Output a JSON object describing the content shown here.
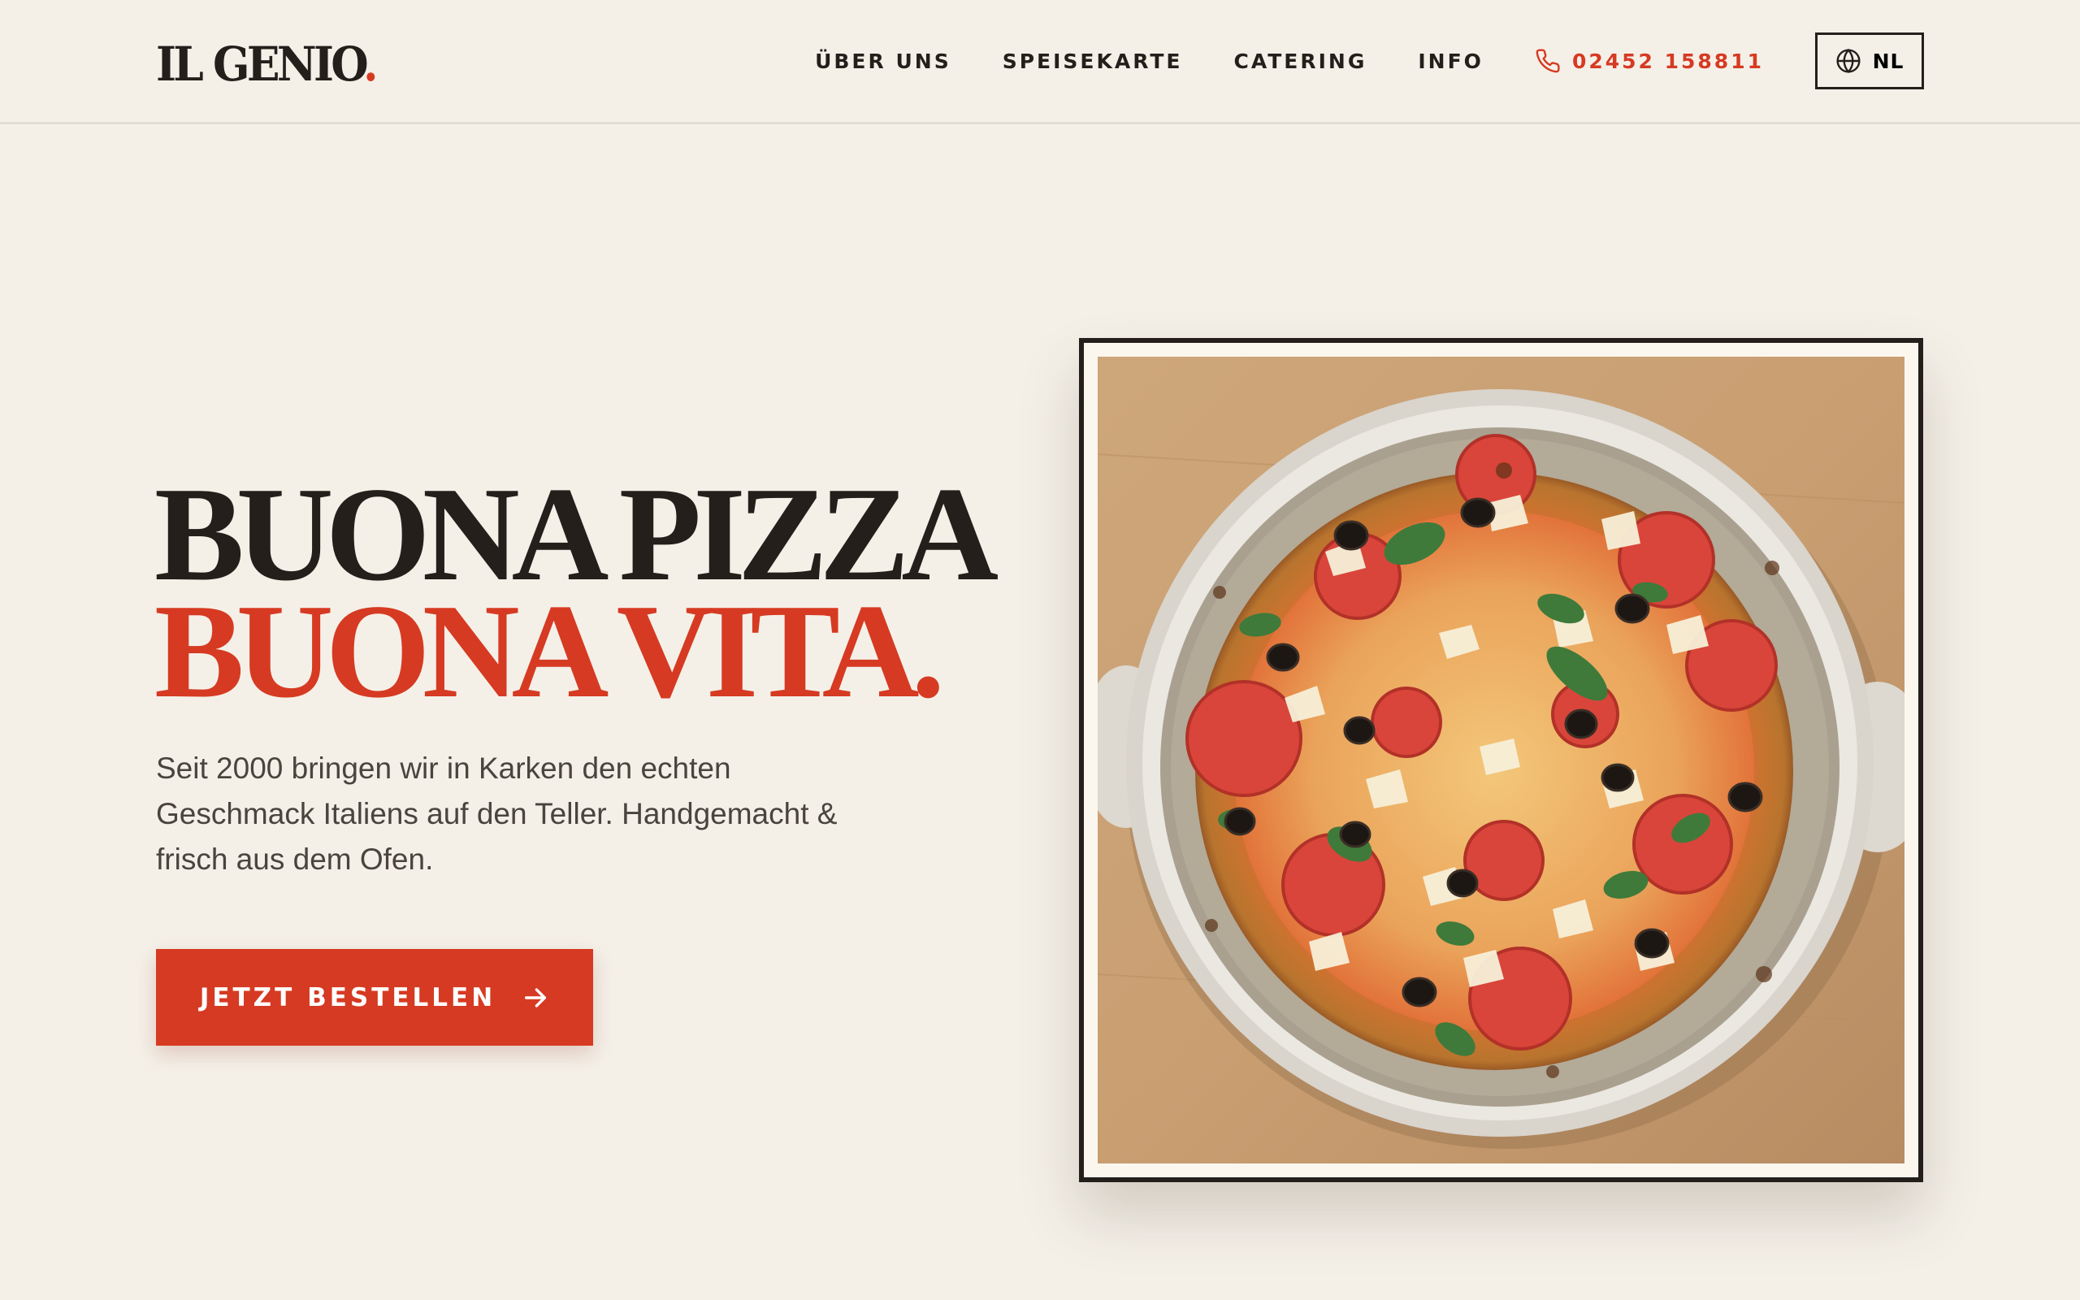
{
  "brand": {
    "logo_text": "IL GENIO",
    "logo_dot": ".",
    "accent_color": "#d63a22",
    "dark_color": "#241f1b",
    "background_color": "#f4f0e8"
  },
  "nav": {
    "items": [
      {
        "label": "ÜBER UNS"
      },
      {
        "label": "SPEISEKARTE"
      },
      {
        "label": "CATERING"
      },
      {
        "label": "INFO"
      }
    ],
    "phone": {
      "icon": "phone-icon",
      "number": "02452 158811"
    },
    "language": {
      "icon": "globe-icon",
      "label": "NL"
    }
  },
  "hero": {
    "headline_line1": "BUONA PIZZA",
    "headline_line2": "BUONA VITA.",
    "description": "Seit 2000 bringen wir in Karken den echten Geschmack Italiens auf den Teller. Handgemacht & frisch aus dem Ofen.",
    "cta_label": "JETZT BESTELLEN",
    "cta_icon": "arrow-right-icon",
    "image": {
      "subject": "pizza-photo"
    }
  }
}
